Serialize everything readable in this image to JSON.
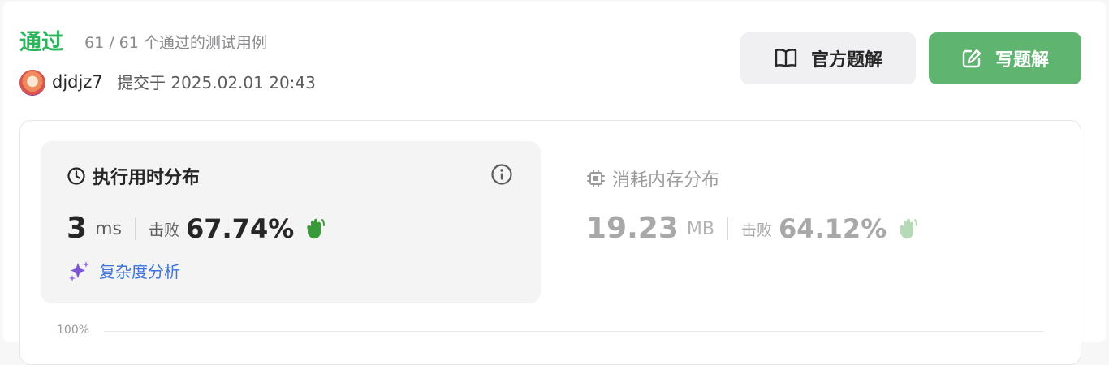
{
  "header": {
    "status": "通过",
    "count_text": "61 / 61 个通过的测试用例",
    "username": "djdjz7",
    "submitted_text": "提交于 2025.02.01 20:43"
  },
  "buttons": {
    "official": "官方题解",
    "write": "写题解"
  },
  "runtime": {
    "title": "执行用时分布",
    "value": "3",
    "unit": "ms",
    "beat_label": "击败",
    "beat_pct": "67.74%",
    "complexity_link": "复杂度分析"
  },
  "memory": {
    "title": "消耗内存分布",
    "value": "19.23",
    "unit": "MB",
    "beat_label": "击败",
    "beat_pct": "64.12%"
  },
  "chart": {
    "y_tick": "100%"
  },
  "colors": {
    "accent_green": "#2db55d",
    "button_green": "#5fb56f",
    "link_blue": "#3f73d8"
  }
}
